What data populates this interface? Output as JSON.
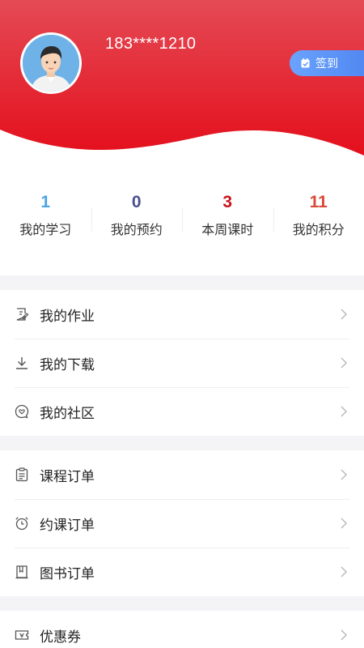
{
  "profile": {
    "phone": "183****1210",
    "checkin_label": "签到"
  },
  "stats": [
    {
      "value": "1",
      "label": "我的学习",
      "color": "#4aa3e6"
    },
    {
      "value": "0",
      "label": "我的预约",
      "color": "#4b4f8f"
    },
    {
      "value": "3",
      "label": "本周课时",
      "color": "#c8161e"
    },
    {
      "value": "11",
      "label": "我的积分",
      "color": "#d84a3a"
    }
  ],
  "menu_group_1": [
    {
      "label": "我的作业",
      "icon": "homework-icon"
    },
    {
      "label": "我的下载",
      "icon": "download-icon"
    },
    {
      "label": "我的社区",
      "icon": "community-icon"
    }
  ],
  "menu_group_2": [
    {
      "label": "课程订单",
      "icon": "course-order-icon"
    },
    {
      "label": "约课订单",
      "icon": "alarm-clock-icon"
    },
    {
      "label": "图书订单",
      "icon": "book-icon"
    }
  ],
  "menu_group_3": [
    {
      "label": "优惠券",
      "icon": "coupon-icon"
    }
  ],
  "colors": {
    "header_red": "#e8202a",
    "checkin_blue": "#5a8ff5"
  }
}
